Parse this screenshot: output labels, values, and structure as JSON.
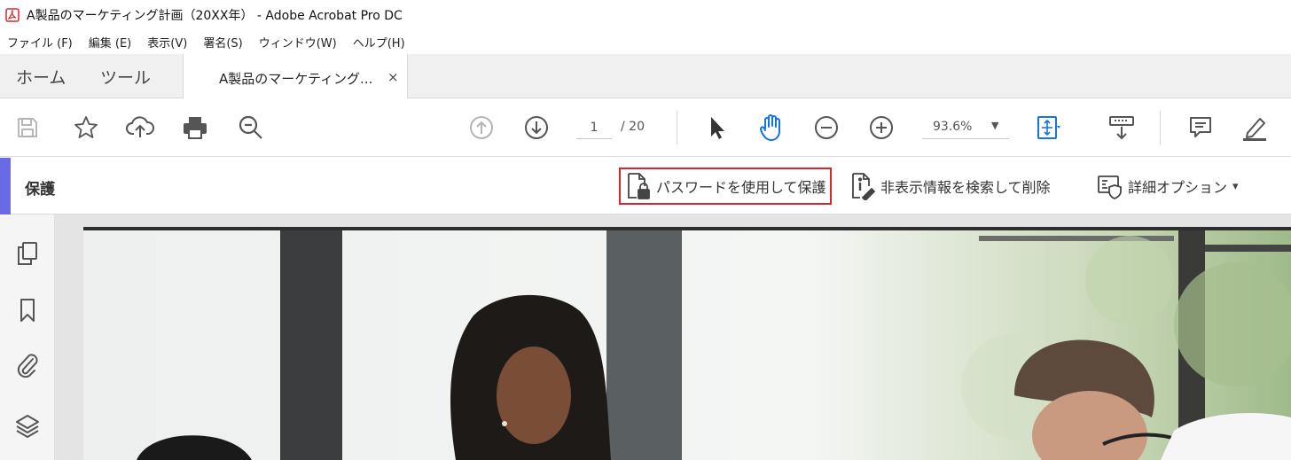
{
  "window": {
    "title": "A製品のマーケティング計画（20XX年） - Adobe Acrobat Pro DC",
    "app_icon": "acrobat-pdf-icon"
  },
  "menubar": {
    "items": [
      {
        "label": "ファイル (F)"
      },
      {
        "label": "編集 (E)"
      },
      {
        "label": "表示(V)"
      },
      {
        "label": "署名(S)"
      },
      {
        "label": "ウィンドウ(W)"
      },
      {
        "label": "ヘルプ(H)"
      }
    ]
  },
  "tabs": {
    "home": "ホーム",
    "tools": "ツール",
    "document": "A製品のマーケティング...",
    "close_glyph": "×"
  },
  "toolbar": {
    "icons": [
      "save-icon",
      "bookmark-star-icon",
      "upload-cloud-icon",
      "print-icon",
      "zoom-search-icon",
      "prev-page-icon",
      "next-page-icon",
      "select-cursor-icon",
      "hand-tool-icon",
      "zoom-out-icon",
      "zoom-in-icon",
      "fit-page-icon",
      "scroll-mode-icon",
      "comment-icon",
      "highlight-pen-icon"
    ],
    "page_current": "1",
    "page_total": "/ 20",
    "zoom": "93.6%",
    "zoom_caret": "▼",
    "accent_color": "#1473e6"
  },
  "protect": {
    "title": "保護",
    "accent_color": "#6a6ae6",
    "buttons": {
      "password": "パスワードを使用して保護",
      "redact": "非表示情報を検索して削除",
      "advanced": "詳細オプション"
    },
    "advanced_caret": "▾",
    "highlight_color": "#d9262c"
  },
  "leftrail": {
    "icons": [
      "page-thumbnails-icon",
      "bookmarks-icon",
      "attachments-icon",
      "layers-icon"
    ]
  }
}
